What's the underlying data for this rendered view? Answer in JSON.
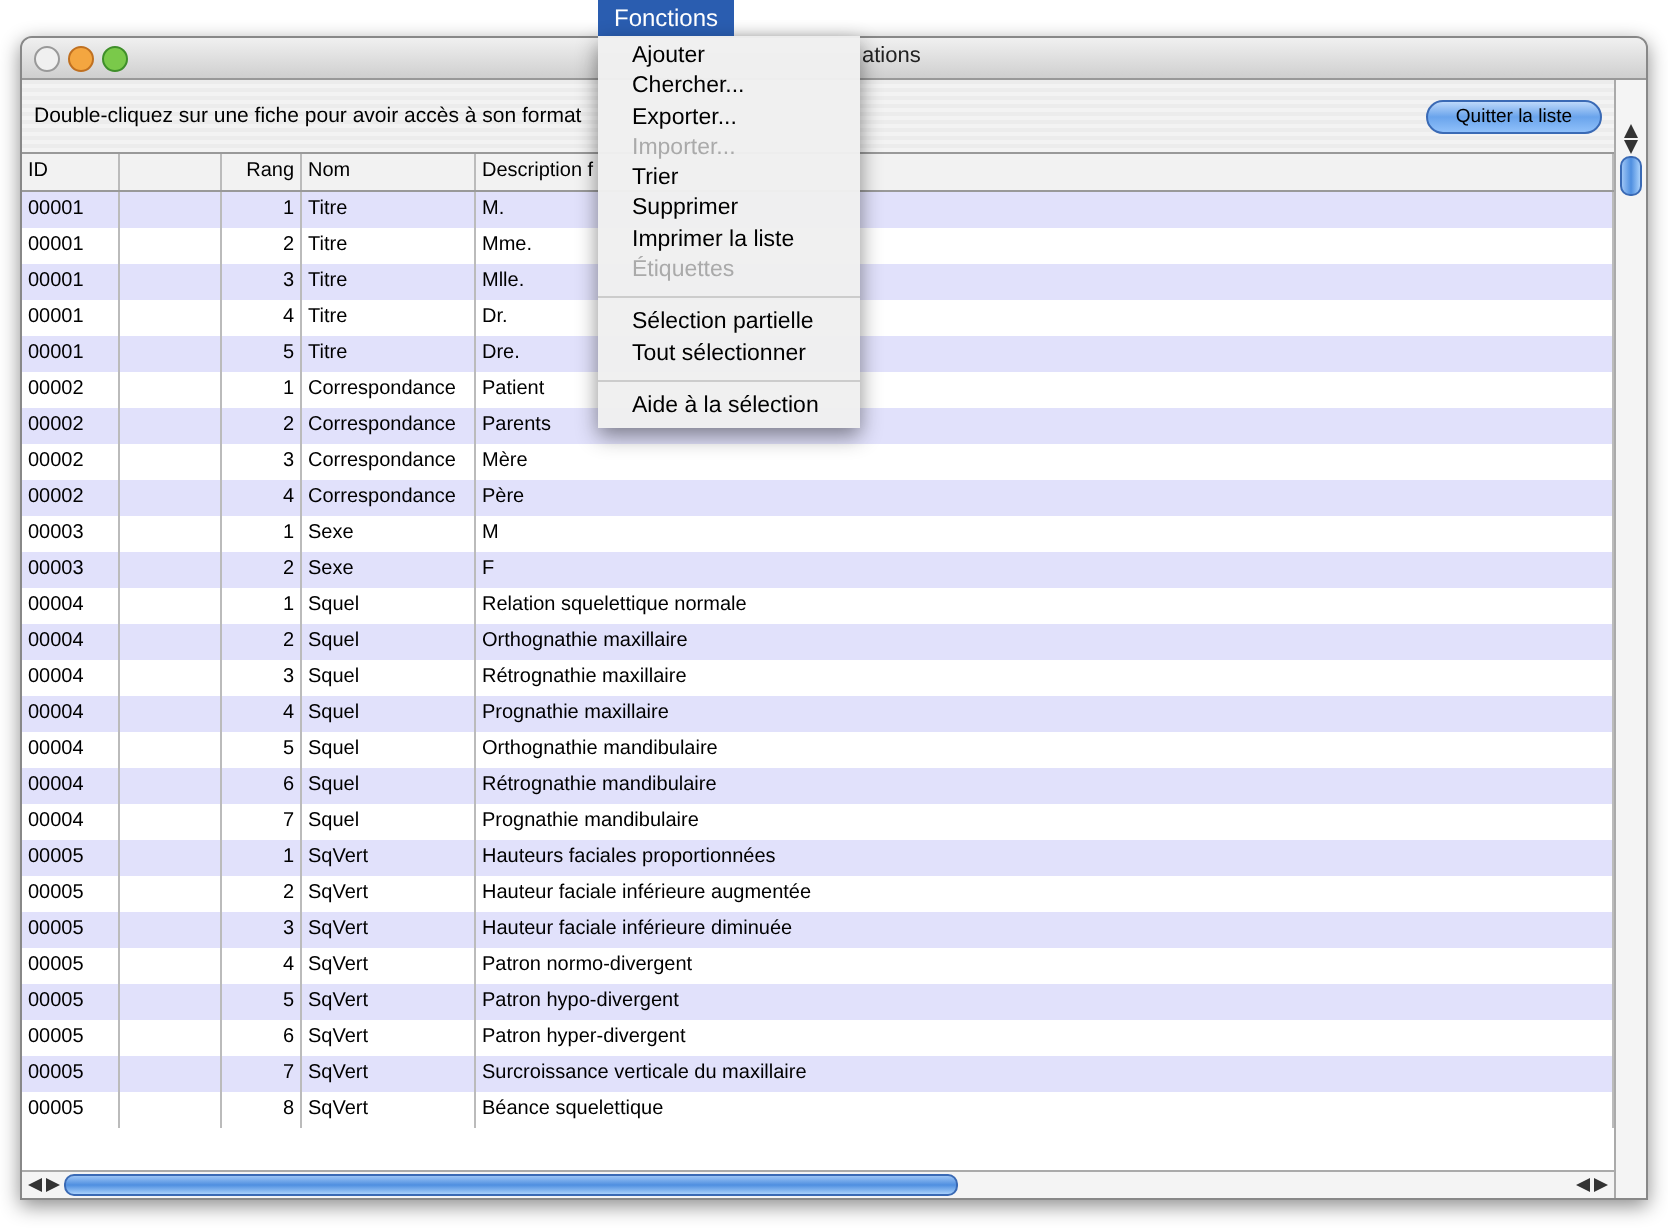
{
  "menu_bar": {
    "title": "Fonctions",
    "open": true
  },
  "menu": {
    "groups": [
      [
        {
          "label": "Ajouter",
          "disabled": false
        },
        {
          "label": "Chercher...",
          "disabled": false
        },
        {
          "label": "Exporter...",
          "disabled": false
        },
        {
          "label": "Importer...",
          "disabled": true
        },
        {
          "label": "Trier",
          "disabled": false
        },
        {
          "label": "Supprimer",
          "disabled": false
        },
        {
          "label": "Imprimer la liste",
          "disabled": false
        },
        {
          "label": "Étiquettes",
          "disabled": true
        }
      ],
      [
        {
          "label": "Sélection partielle",
          "disabled": false
        },
        {
          "label": "Tout sélectionner",
          "disabled": false
        }
      ],
      [
        {
          "label": "Aide à la sélection",
          "disabled": false
        }
      ]
    ]
  },
  "window": {
    "title": "ations"
  },
  "toolbar": {
    "instruction": "Double-cliquez sur une fiche pour avoir accès à son format",
    "button": "Quitter la liste"
  },
  "table": {
    "columns": [
      "ID",
      "",
      "Rang",
      "Nom",
      "Description f"
    ],
    "rows": [
      [
        "00001",
        "",
        "1",
        "Titre",
        "M."
      ],
      [
        "00001",
        "",
        "2",
        "Titre",
        "Mme."
      ],
      [
        "00001",
        "",
        "3",
        "Titre",
        "Mlle."
      ],
      [
        "00001",
        "",
        "4",
        "Titre",
        "Dr."
      ],
      [
        "00001",
        "",
        "5",
        "Titre",
        "Dre."
      ],
      [
        "00002",
        "",
        "1",
        "Correspondance",
        "Patient"
      ],
      [
        "00002",
        "",
        "2",
        "Correspondance",
        "Parents"
      ],
      [
        "00002",
        "",
        "3",
        "Correspondance",
        "Mère"
      ],
      [
        "00002",
        "",
        "4",
        "Correspondance",
        "Père"
      ],
      [
        "00003",
        "",
        "1",
        "Sexe",
        "M"
      ],
      [
        "00003",
        "",
        "2",
        "Sexe",
        "F"
      ],
      [
        "00004",
        "",
        "1",
        "Squel",
        "Relation squelettique normale"
      ],
      [
        "00004",
        "",
        "2",
        "Squel",
        "Orthognathie maxillaire"
      ],
      [
        "00004",
        "",
        "3",
        "Squel",
        "Rétrognathie maxillaire"
      ],
      [
        "00004",
        "",
        "4",
        "Squel",
        "Prognathie maxillaire"
      ],
      [
        "00004",
        "",
        "5",
        "Squel",
        "Orthognathie mandibulaire"
      ],
      [
        "00004",
        "",
        "6",
        "Squel",
        "Rétrognathie mandibulaire"
      ],
      [
        "00004",
        "",
        "7",
        "Squel",
        "Prognathie mandibulaire"
      ],
      [
        "00005",
        "",
        "1",
        "SqVert",
        "Hauteurs faciales proportionnées"
      ],
      [
        "00005",
        "",
        "2",
        "SqVert",
        "Hauteur faciale inférieure augmentée"
      ],
      [
        "00005",
        "",
        "3",
        "SqVert",
        "Hauteur faciale inférieure diminuée"
      ],
      [
        "00005",
        "",
        "4",
        "SqVert",
        "Patron normo-divergent"
      ],
      [
        "00005",
        "",
        "5",
        "SqVert",
        "Patron hypo-divergent"
      ],
      [
        "00005",
        "",
        "6",
        "SqVert",
        "Patron hyper-divergent"
      ],
      [
        "00005",
        "",
        "7",
        "SqVert",
        "Surcroissance verticale du maxillaire"
      ],
      [
        "00005",
        "",
        "8",
        "SqVert",
        "Béance squelettique"
      ]
    ]
  }
}
